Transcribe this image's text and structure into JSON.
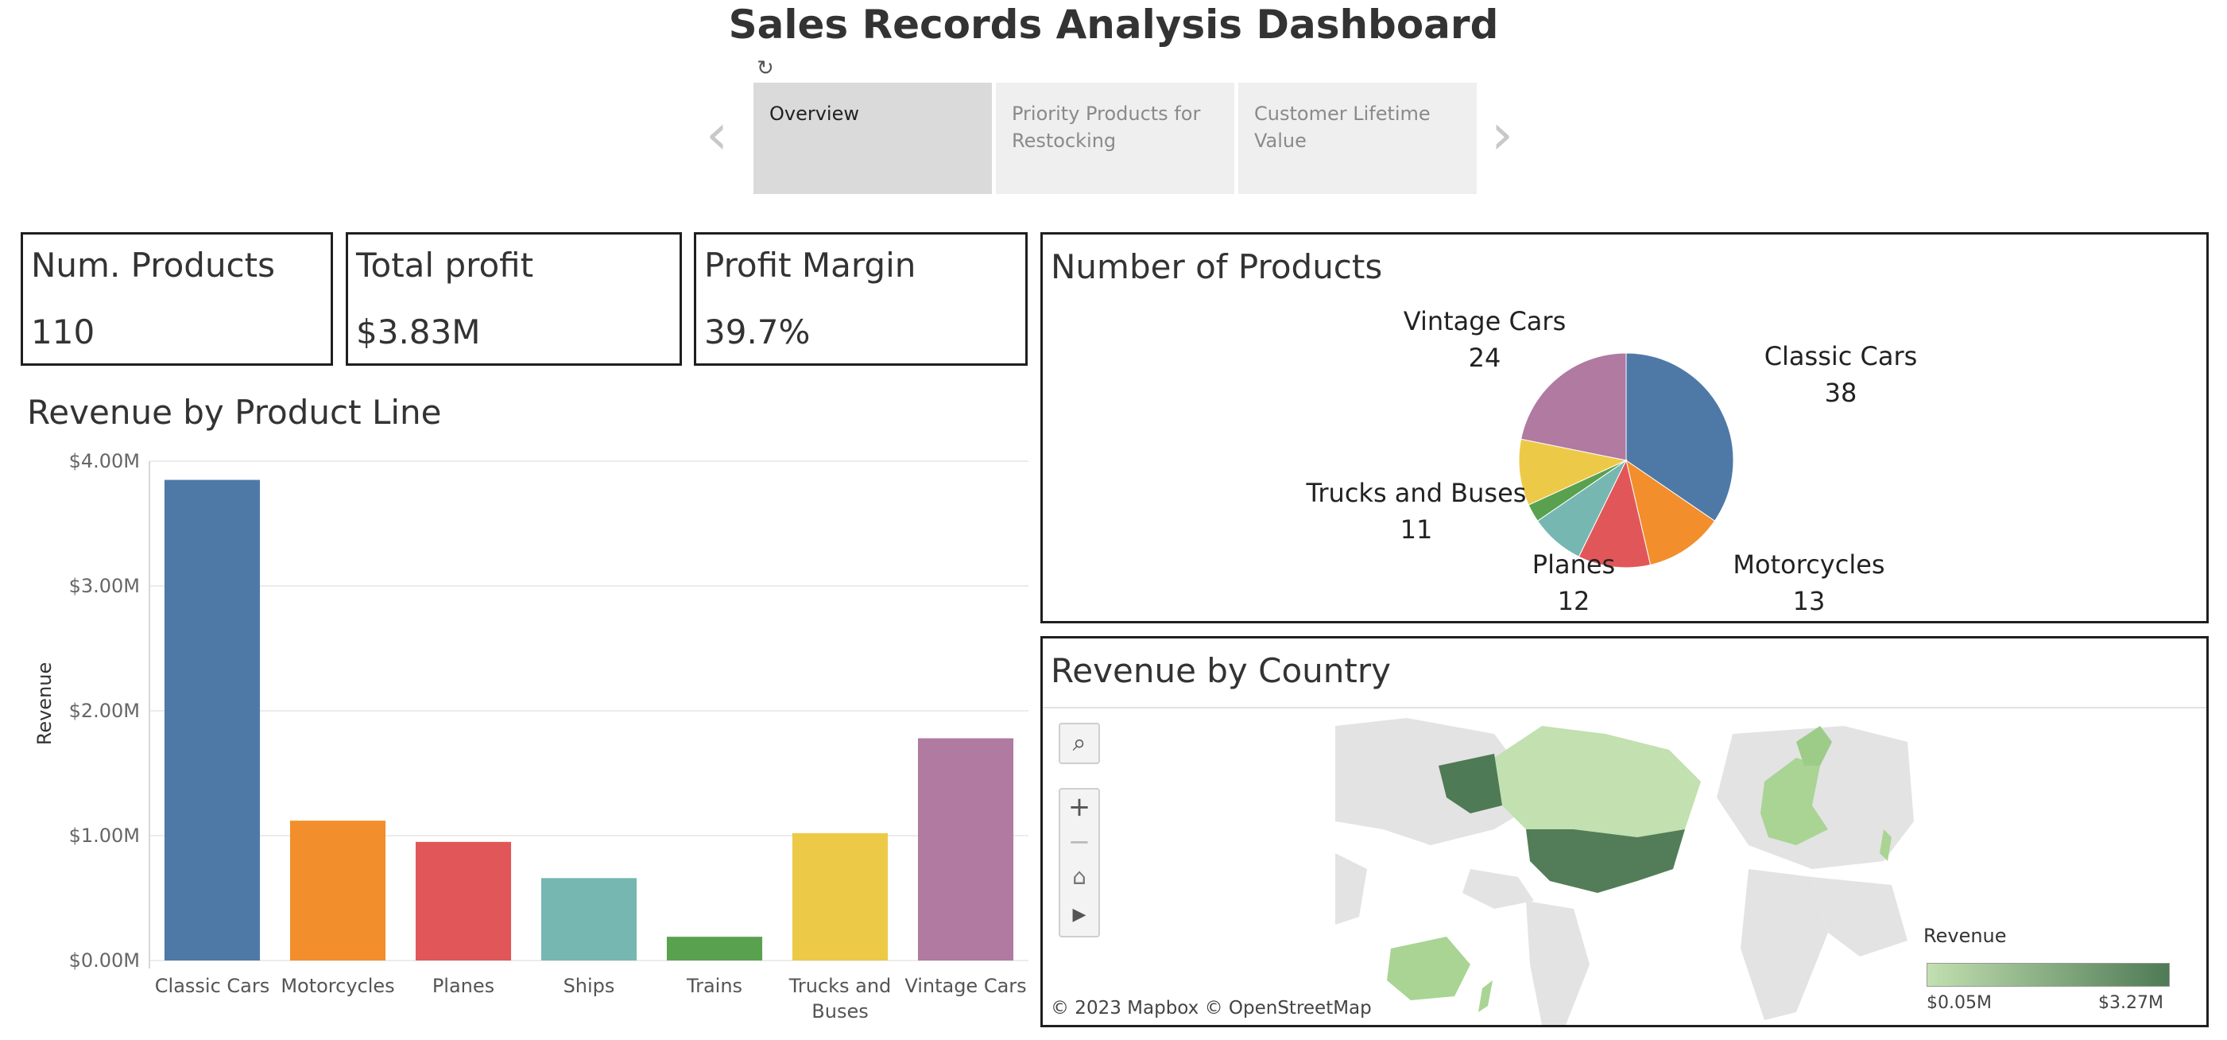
{
  "dashboard": {
    "title": "Sales Records Analysis Dashboard"
  },
  "story_nav": {
    "tabs": [
      {
        "label": "Overview",
        "active": true
      },
      {
        "label": "Priority Products for Restocking",
        "active": false
      },
      {
        "label": "Customer Lifetime Value",
        "active": false
      }
    ],
    "prev_icon": "chevron-left-icon",
    "next_icon": "chevron-right-icon",
    "refresh_icon": "refresh-icon"
  },
  "kpis": [
    {
      "label": "Num. Products",
      "value": "110"
    },
    {
      "label": "Total profit",
      "value": "$3.83M"
    },
    {
      "label": "Profit Margin",
      "value": "39.7%"
    }
  ],
  "colors": {
    "Classic Cars": "#4e79a7",
    "Motorcycles": "#f28e2b",
    "Planes": "#e15759",
    "Ships": "#76b7b2",
    "Trains": "#59a14f",
    "Trucks and Buses": "#edc948",
    "Vintage Cars": "#b07aa1"
  },
  "bar_panel": {
    "title": "Revenue by Product Line",
    "ylabel": "Revenue"
  },
  "pie_panel": {
    "title": "Number of Products"
  },
  "map_panel": {
    "title": "Revenue by Country",
    "attribution": "© 2023 Mapbox  © OpenStreetMap",
    "legend_title": "Revenue",
    "legend_min": "$0.05M",
    "legend_max": "$3.27M",
    "legend_color_low": "#c2e0b0",
    "legend_color_high": "#4e7a55",
    "controls": [
      "search-icon",
      "zoom-in-icon",
      "zoom-out-icon",
      "home-icon",
      "play-icon"
    ]
  },
  "chart_data": [
    {
      "type": "bar",
      "title": "Revenue by Product Line",
      "xlabel": "",
      "ylabel": "Revenue",
      "categories": [
        "Classic Cars",
        "Motorcycles",
        "Planes",
        "Ships",
        "Trains",
        "Trucks and Buses",
        "Vintage Cars"
      ],
      "values": [
        3.85,
        1.12,
        0.95,
        0.66,
        0.19,
        1.02,
        1.78
      ],
      "unit": "$M",
      "yticks": [
        "$0.00M",
        "$1.00M",
        "$2.00M",
        "$3.00M",
        "$4.00M"
      ],
      "ylim": [
        0,
        4
      ],
      "grid": true
    },
    {
      "type": "pie",
      "title": "Number of Products",
      "categories": [
        "Classic Cars",
        "Motorcycles",
        "Planes",
        "Ships",
        "Trains",
        "Trucks and Buses",
        "Vintage Cars"
      ],
      "values": [
        38,
        13,
        12,
        9,
        3,
        11,
        24
      ],
      "labels_shown": [
        "Classic Cars",
        "Motorcycles",
        "Planes",
        "Trucks and Buses",
        "Vintage Cars"
      ]
    }
  ]
}
